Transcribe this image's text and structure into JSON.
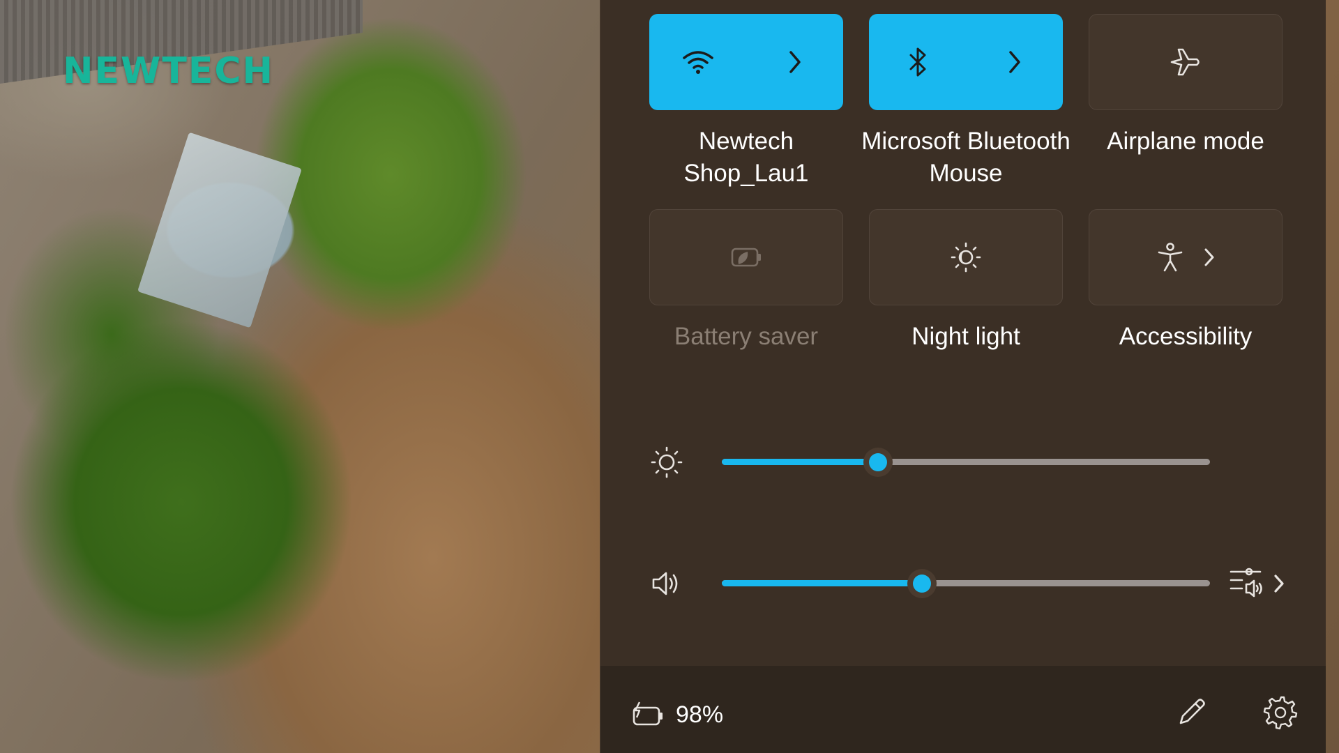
{
  "wallpaper": {
    "logo_text": "NEWTECH"
  },
  "quick_settings": {
    "tiles": [
      {
        "id": "wifi",
        "label": "Newtech Shop_Lau1",
        "state": "on",
        "icon": "wifi-icon",
        "has_chevron": true
      },
      {
        "id": "bluetooth",
        "label": "Microsoft Bluetooth Mouse",
        "state": "on",
        "icon": "bluetooth-icon",
        "has_chevron": true
      },
      {
        "id": "airplane",
        "label": "Airplane mode",
        "state": "off",
        "icon": "airplane-icon",
        "has_chevron": false
      },
      {
        "id": "battery_saver",
        "label": "Battery saver",
        "state": "disabled",
        "icon": "battery-saver-icon",
        "has_chevron": false
      },
      {
        "id": "night_light",
        "label": "Night light",
        "state": "off",
        "icon": "night-light-icon",
        "has_chevron": false
      },
      {
        "id": "accessibility",
        "label": "Accessibility",
        "state": "off",
        "icon": "accessibility-icon",
        "has_chevron": true
      }
    ],
    "brightness": {
      "icon": "brightness-icon",
      "value_fraction": 0.32
    },
    "volume": {
      "icon": "volume-icon",
      "value_fraction": 0.41,
      "output_icon": "audio-output-icon"
    },
    "footer": {
      "battery_icon": "battery-charging-icon",
      "battery_percent": "98%",
      "edit_icon": "pencil-icon",
      "settings_icon": "gear-icon"
    }
  },
  "colors": {
    "accent": "#19b8ef",
    "panel_bg": "#3b2f25",
    "footer_bg": "#2f261e",
    "tile_off_bg": "#43362b",
    "text": "#ffffff",
    "text_disabled": "#8b7f74",
    "logo": "#18b59a"
  }
}
